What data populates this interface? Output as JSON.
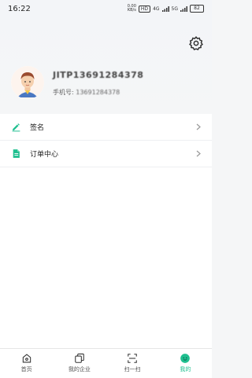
{
  "status_bar": {
    "time": "16:22",
    "speed": "0.00\nKB/s",
    "hd": "HD",
    "network": "4G",
    "signal": "5G",
    "battery": "82"
  },
  "profile": {
    "username": "JITP13691284378",
    "phone_label": "手机号:",
    "phone_value": "13691284378"
  },
  "menu": {
    "items": [
      {
        "label": "签名",
        "icon": "pen-icon"
      },
      {
        "label": "订单中心",
        "icon": "document-icon"
      }
    ]
  },
  "tabbar": {
    "tabs": [
      {
        "label": "首页",
        "icon": "home-icon",
        "active": false
      },
      {
        "label": "我的企业",
        "icon": "copy-icon",
        "active": false
      },
      {
        "label": "扫一扫",
        "icon": "scan-icon",
        "active": false
      },
      {
        "label": "我的",
        "icon": "profile-icon",
        "active": true
      }
    ]
  },
  "colors": {
    "accent": "#1fbf8f",
    "background": "#f5f6f7"
  }
}
